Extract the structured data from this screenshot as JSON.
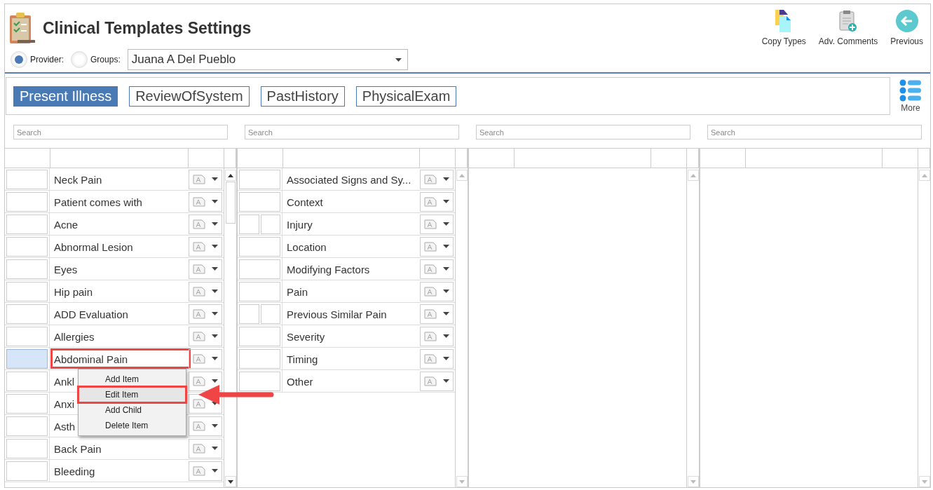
{
  "window": {
    "title": "Clinical Templates Settings"
  },
  "filter": {
    "options": [
      {
        "label": "Provider:",
        "selected": true
      },
      {
        "label": "Groups:",
        "selected": false
      }
    ],
    "dropdown": {
      "value": "Juana A Del Pueblo"
    }
  },
  "toolbar": [
    {
      "label": "Copy Types",
      "kind": "copy"
    },
    {
      "label": "Adv. Comments",
      "kind": "comments"
    },
    {
      "label": "Previous",
      "kind": "back"
    }
  ],
  "tabs": [
    {
      "label": "Present Illness",
      "selected": true
    },
    {
      "label": "ReviewOfSystem",
      "selected": false
    },
    {
      "label": "PastHistory",
      "selected": false
    },
    {
      "label": "PhysicalExam",
      "selected": false
    }
  ],
  "more": {
    "label": "More"
  },
  "panels": [
    {
      "search": {
        "placeholder": "Search"
      },
      "rows": [
        {
          "label": "Neck Pain",
          "kind": "item",
          "selected": false
        },
        {
          "label": "Patient comes with",
          "kind": "item",
          "selected": false
        },
        {
          "label": "Acne",
          "kind": "item",
          "selected": false
        },
        {
          "label": "Abnormal Lesion",
          "kind": "item",
          "selected": false
        },
        {
          "label": "Eyes",
          "kind": "item",
          "selected": false
        },
        {
          "label": "Hip pain",
          "kind": "item",
          "selected": false
        },
        {
          "label": "ADD Evaluation",
          "kind": "item",
          "selected": false
        },
        {
          "label": "Allergies",
          "kind": "item",
          "selected": false
        },
        {
          "label": "Abdominal Pain",
          "kind": "item",
          "selected": true
        },
        {
          "label": "Ankl",
          "kind": "item",
          "selected": false
        },
        {
          "label": "Anxi",
          "kind": "item",
          "selected": false
        },
        {
          "label": "Asth",
          "kind": "item",
          "selected": false
        },
        {
          "label": "Back Pain",
          "kind": "item",
          "selected": false
        },
        {
          "label": "Bleeding",
          "kind": "item",
          "selected": false
        }
      ]
    },
    {
      "search": {
        "placeholder": "Search"
      },
      "rows": [
        {
          "label": "Associated Signs and Sy...",
          "kind": "item",
          "selected": false
        },
        {
          "label": "Context",
          "kind": "item",
          "selected": false
        },
        {
          "label": "Injury",
          "kind": "child",
          "selected": false
        },
        {
          "label": "Location",
          "kind": "item",
          "selected": false
        },
        {
          "label": "Modifying Factors",
          "kind": "item",
          "selected": false
        },
        {
          "label": "Pain",
          "kind": "item",
          "selected": false
        },
        {
          "label": "Previous Similar Pain",
          "kind": "child",
          "selected": false
        },
        {
          "label": "Severity",
          "kind": "item",
          "selected": false
        },
        {
          "label": "Timing",
          "kind": "item",
          "selected": false
        },
        {
          "label": "Other",
          "kind": "item",
          "selected": false
        }
      ]
    },
    {
      "search": {
        "placeholder": "Search"
      }
    },
    {
      "search": {
        "placeholder": "Search"
      }
    }
  ],
  "context_menu": {
    "items": [
      {
        "label": "Add Item",
        "highlighted": false
      },
      {
        "label": "Edit Item",
        "highlighted": true
      },
      {
        "label": "Add Child",
        "highlighted": false
      },
      {
        "label": "Delete Item",
        "highlighted": false
      }
    ]
  }
}
